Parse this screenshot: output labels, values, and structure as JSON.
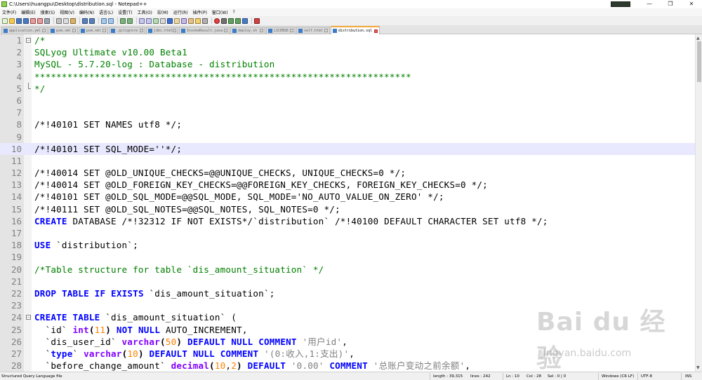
{
  "window": {
    "title": "C:\\Users\\huangpu\\Desktop\\distribution.sql - Notepad++",
    "controls": {
      "minimize": "—",
      "maximize": "❐",
      "close": "✕"
    }
  },
  "menu": [
    "文件(F)",
    "编辑(E)",
    "搜索(S)",
    "视图(V)",
    "编码(N)",
    "语言(L)",
    "设置(T)",
    "工具(O)",
    "宏(M)",
    "运行(R)",
    "插件(P)",
    "窗口(W)",
    "?"
  ],
  "tabs": [
    {
      "label": "application.yml"
    },
    {
      "label": "pom.xml"
    },
    {
      "label": "pom.xml"
    },
    {
      "label": ".gitignore"
    },
    {
      "label": "jdbc.html"
    },
    {
      "label": "InvokeResult.java"
    },
    {
      "label": "deploy.sh"
    },
    {
      "label": "LICENSE"
    },
    {
      "label": "self.html"
    },
    {
      "label": "distribution.sql",
      "active": true
    }
  ],
  "editor": {
    "current_line": 10,
    "lines": [
      {
        "n": "1",
        "fold": "open",
        "tokens": [
          [
            "comment",
            "/*"
          ]
        ]
      },
      {
        "n": "2",
        "tokens": [
          [
            "comment",
            "SQLyog Ultimate v10.00 Beta1"
          ]
        ]
      },
      {
        "n": "3",
        "tokens": [
          [
            "comment",
            "MySQL - 5.7.20-log : Database - distribution"
          ]
        ]
      },
      {
        "n": "4",
        "tokens": [
          [
            "comment",
            "*********************************************************************"
          ]
        ]
      },
      {
        "n": "5",
        "fold": "end",
        "tokens": [
          [
            "comment",
            "*/"
          ]
        ]
      },
      {
        "n": "6",
        "tokens": []
      },
      {
        "n": "7",
        "tokens": []
      },
      {
        "n": "8",
        "tokens": [
          [
            "plain",
            "/*!40101 SET NAMES utf8 */;"
          ]
        ]
      },
      {
        "n": "9",
        "tokens": []
      },
      {
        "n": "10",
        "tokens": [
          [
            "plain",
            "/*!40101 SET SQL_MODE=''*/;"
          ]
        ]
      },
      {
        "n": "11",
        "tokens": []
      },
      {
        "n": "12",
        "tokens": [
          [
            "plain",
            "/*!40014 SET @OLD_UNIQUE_CHECKS=@@UNIQUE_CHECKS, UNIQUE_CHECKS=0 */;"
          ]
        ]
      },
      {
        "n": "13",
        "tokens": [
          [
            "plain",
            "/*!40014 SET @OLD_FOREIGN_KEY_CHECKS=@@FOREIGN_KEY_CHECKS, FOREIGN_KEY_CHECKS=0 */;"
          ]
        ]
      },
      {
        "n": "14",
        "tokens": [
          [
            "plain",
            "/*!40101 SET @OLD_SQL_MODE=@@SQL_MODE, SQL_MODE='NO_AUTO_VALUE_ON_ZERO' */;"
          ]
        ]
      },
      {
        "n": "15",
        "tokens": [
          [
            "plain",
            "/*!40111 SET @OLD_SQL_NOTES=@@SQL_NOTES, SQL_NOTES=0 */;"
          ]
        ]
      },
      {
        "n": "16",
        "tokens": [
          [
            "kw",
            "CREATE"
          ],
          [
            "plain",
            " DATABASE /*!32312 IF NOT EXISTS*/`distribution` /*!40100 DEFAULT CHARACTER SET utf8 */;"
          ]
        ]
      },
      {
        "n": "17",
        "tokens": []
      },
      {
        "n": "18",
        "tokens": [
          [
            "kw",
            "USE"
          ],
          [
            "plain",
            " `distribution`;"
          ]
        ]
      },
      {
        "n": "19",
        "tokens": []
      },
      {
        "n": "20",
        "tokens": [
          [
            "comment",
            "/*Table structure for table `dis_amount_situation` */"
          ]
        ]
      },
      {
        "n": "21",
        "tokens": []
      },
      {
        "n": "22",
        "tokens": [
          [
            "kw",
            "DROP"
          ],
          [
            "plain",
            " "
          ],
          [
            "kw",
            "TABLE"
          ],
          [
            "plain",
            " "
          ],
          [
            "kw",
            "IF"
          ],
          [
            "plain",
            " "
          ],
          [
            "kw",
            "EXISTS"
          ],
          [
            "plain",
            " `dis_amount_situation`;"
          ]
        ]
      },
      {
        "n": "23",
        "tokens": []
      },
      {
        "n": "24",
        "fold": "open",
        "tokens": [
          [
            "kw",
            "CREATE"
          ],
          [
            "plain",
            " "
          ],
          [
            "kw",
            "TABLE"
          ],
          [
            "plain",
            " `dis_amount_situation` ("
          ]
        ]
      },
      {
        "n": "25",
        "tokens": [
          [
            "plain",
            "  `id` "
          ],
          [
            "type",
            "int"
          ],
          [
            "op",
            "("
          ],
          [
            "num",
            "11"
          ],
          [
            "op",
            ")"
          ],
          [
            "plain",
            " "
          ],
          [
            "kw",
            "NOT"
          ],
          [
            "plain",
            " "
          ],
          [
            "kw",
            "NULL"
          ],
          [
            "plain",
            " AUTO_INCREMENT,"
          ]
        ]
      },
      {
        "n": "26",
        "tokens": [
          [
            "plain",
            "  `dis_user_id` "
          ],
          [
            "type",
            "varchar"
          ],
          [
            "op",
            "("
          ],
          [
            "num",
            "50"
          ],
          [
            "op",
            ")"
          ],
          [
            "plain",
            " "
          ],
          [
            "kw",
            "DEFAULT"
          ],
          [
            "plain",
            " "
          ],
          [
            "kw",
            "NULL"
          ],
          [
            "plain",
            " "
          ],
          [
            "kw",
            "COMMENT"
          ],
          [
            "plain",
            " "
          ],
          [
            "str",
            "'用户id'"
          ],
          [
            "plain",
            ","
          ]
        ]
      },
      {
        "n": "27",
        "tokens": [
          [
            "plain",
            "  `"
          ],
          [
            "kw",
            "type"
          ],
          [
            "plain",
            "` "
          ],
          [
            "type",
            "varchar"
          ],
          [
            "op",
            "("
          ],
          [
            "num",
            "10"
          ],
          [
            "op",
            ")"
          ],
          [
            "plain",
            " "
          ],
          [
            "kw",
            "DEFAULT"
          ],
          [
            "plain",
            " "
          ],
          [
            "kw",
            "NULL"
          ],
          [
            "plain",
            " "
          ],
          [
            "kw",
            "COMMENT"
          ],
          [
            "plain",
            " "
          ],
          [
            "str",
            "'(0:收入,1:支出)'"
          ],
          [
            "plain",
            ","
          ]
        ]
      },
      {
        "n": "28",
        "tokens": [
          [
            "plain",
            "  `before_change_amount` "
          ],
          [
            "type",
            "decimal"
          ],
          [
            "op",
            "("
          ],
          [
            "num",
            "10"
          ],
          [
            "plain",
            ","
          ],
          [
            "num",
            "2"
          ],
          [
            "op",
            ")"
          ],
          [
            "plain",
            " "
          ],
          [
            "kw",
            "DEFAULT"
          ],
          [
            "plain",
            " "
          ],
          [
            "str",
            "'0.00'"
          ],
          [
            "plain",
            " "
          ],
          [
            "kw",
            "COMMENT"
          ],
          [
            "plain",
            " "
          ],
          [
            "str",
            "'总账户变动之前余额'"
          ],
          [
            "plain",
            ","
          ]
        ]
      }
    ]
  },
  "watermark": {
    "logo": "Bai du 经验",
    "url": "jingyan.baidu.com"
  },
  "status": {
    "language": "Structured Query Language file",
    "length": "length : 39,315",
    "lines": "lines : 242",
    "ln": "Ln : 10",
    "col": "Col : 28",
    "sel": "Sel : 0 | 0",
    "eol": "Windows (CR LF)",
    "encoding": "UTF-8",
    "mode": "INS"
  },
  "colors": {
    "comment": "#008000",
    "keyword": "#0000ff",
    "type": "#8000ff",
    "number": "#ff8000",
    "string": "#808080",
    "current_line": "#e8e8ff",
    "active_tab_accent": "#f4a93a"
  }
}
